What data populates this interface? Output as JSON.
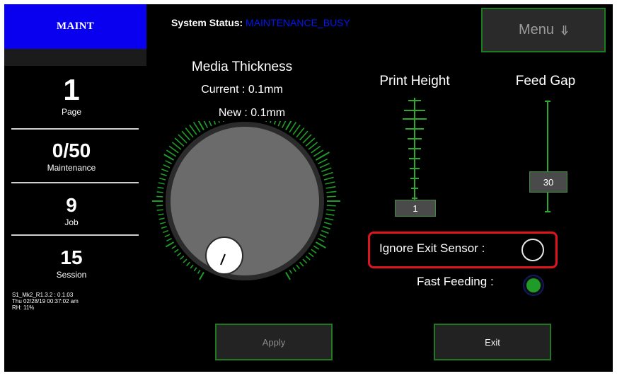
{
  "sidebar": {
    "mode": "MAINT",
    "stats": [
      {
        "value": "1",
        "label": "Page"
      },
      {
        "value": "0/50",
        "label": "Maintenance"
      },
      {
        "value": "9",
        "label": "Job"
      },
      {
        "value": "15",
        "label": "Session"
      }
    ],
    "version_lines": [
      "S1_Mk2_R1.3.2 : 0.1.03",
      "Thu 02/28/19 00:37:02 am",
      "RH: 11%"
    ]
  },
  "header": {
    "status_label": "System Status:",
    "status_value": "MAINTENANCE_BUSY",
    "menu_label": "Menu",
    "menu_icon": "double-arrow-down-icon"
  },
  "media_thickness": {
    "title": "Media Thickness",
    "current": "Current : 0.1mm",
    "new": "New : 0.1mm"
  },
  "print_height": {
    "title": "Print Height",
    "value": "1"
  },
  "feed_gap": {
    "title": "Feed Gap",
    "value": "30"
  },
  "toggles": {
    "ignore_exit_sensor": {
      "label": "Ignore Exit Sensor :",
      "on": false
    },
    "fast_feeding": {
      "label": "Fast Feeding :",
      "on": true
    }
  },
  "buttons": {
    "apply": "Apply",
    "exit": "Exit"
  },
  "colors": {
    "accent_green": "#1f9c28",
    "mode_blue": "#0a00f0",
    "highlight_red": "#e0141c",
    "status_blue": "#0018f5"
  }
}
